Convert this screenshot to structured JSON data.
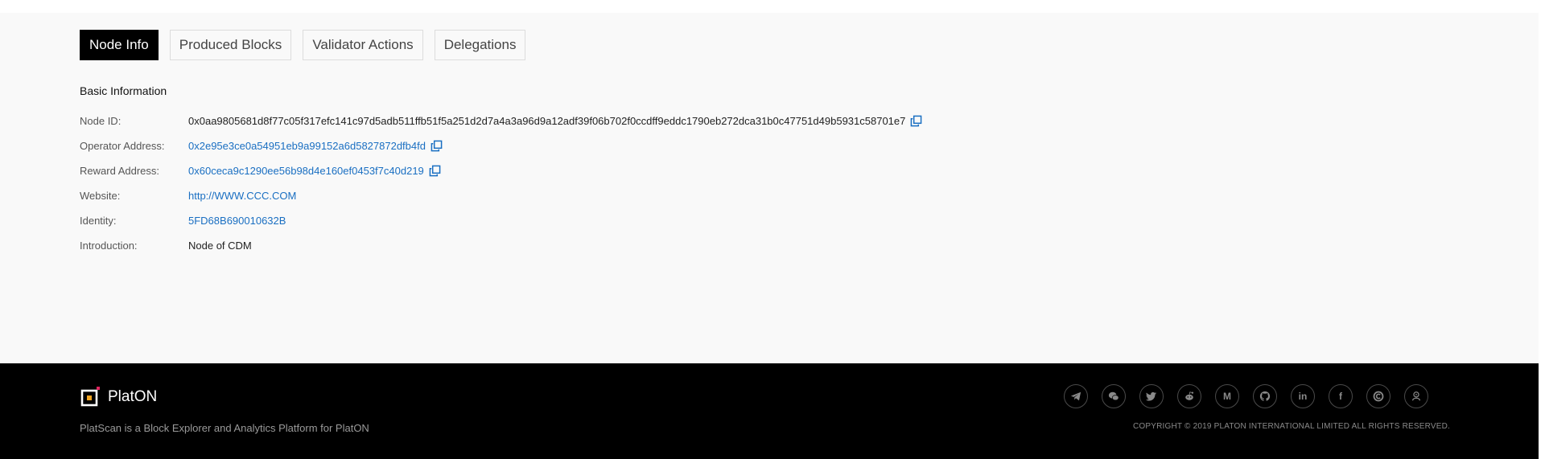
{
  "tabs": {
    "node_info": "Node Info",
    "produced_blocks": "Produced Blocks",
    "validator_actions": "Validator Actions",
    "delegations": "Delegations"
  },
  "basic_info": {
    "title": "Basic Information",
    "node_id_label": "Node ID:",
    "node_id_value": "0x0aa9805681d8f77c05f317efc141c97d5adb511ffb51f5a251d2d7a4a3a96d9a12adf39f06b702f0ccdff9eddc1790eb272dca31b0c47751d49b5931c58701e7",
    "operator_label": "Operator Address:",
    "operator_value": "0x2e95e3ce0a54951eb9a99152a6d5827872dfb4fd",
    "reward_label": "Reward Address:",
    "reward_value": "0x60ceca9c1290ee56b98d4e160ef0453f7c40d219",
    "website_label": "Website:",
    "website_value": "http://WWW.CCC.COM",
    "identity_label": "Identity:",
    "identity_value": "5FD68B690010632B",
    "introduction_label": "Introduction:",
    "introduction_value": "Node of CDM"
  },
  "footer": {
    "brand": "PlatON",
    "tagline": "PlatScan is a Block Explorer and Analytics Platform for PlatON",
    "copyright": "COPYRIGHT © 2019 PLATON INTERNATIONAL LIMITED ALL RIGHTS RESERVED.",
    "socials": [
      "telegram-icon",
      "wechat-icon",
      "twitter-icon",
      "reddit-icon",
      "medium-icon",
      "github-icon",
      "linkedin-icon",
      "facebook-icon",
      "coinmarketcap-icon",
      "keybase-icon"
    ],
    "medium_glyph": "M",
    "linkedin_glyph": "in",
    "facebook_glyph": "f"
  },
  "colors": {
    "link": "#1a6fc2",
    "active_tab_bg": "#000000",
    "content_bg": "#f9f9f9",
    "footer_bg": "#000000",
    "brand_accent": "#f5a623"
  }
}
